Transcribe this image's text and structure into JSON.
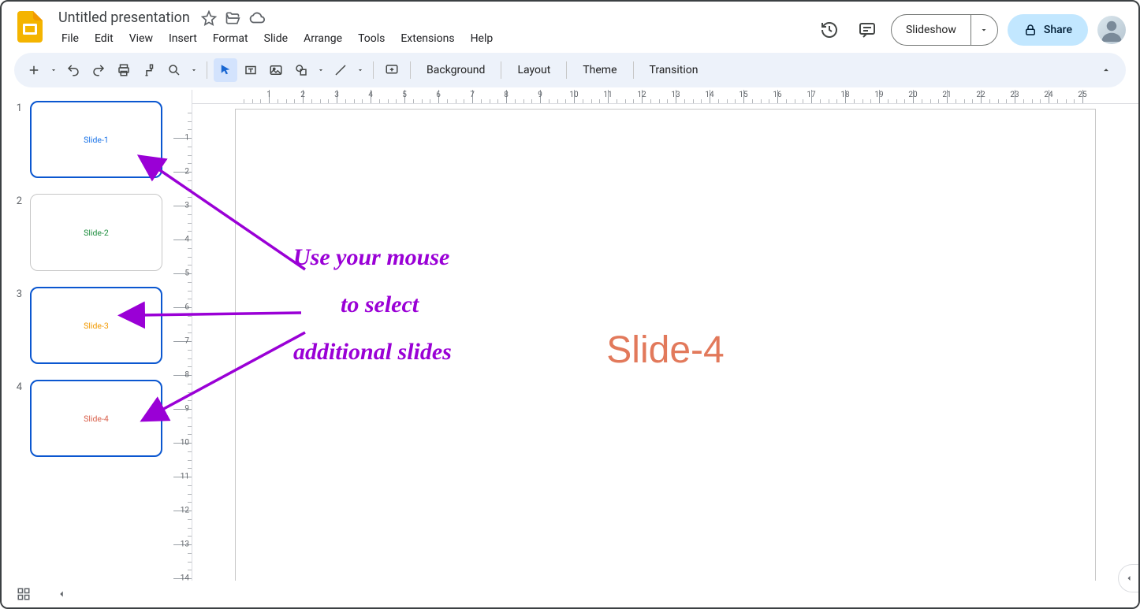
{
  "doc_title": "Untitled presentation",
  "menu": {
    "file": "File",
    "edit": "Edit",
    "view": "View",
    "insert": "Insert",
    "format": "Format",
    "slide": "Slide",
    "arrange": "Arrange",
    "tools": "Tools",
    "extensions": "Extensions",
    "help": "Help"
  },
  "header_buttons": {
    "slideshow": "Slideshow",
    "share": "Share"
  },
  "toolbar_text": {
    "background": "Background",
    "layout": "Layout",
    "theme": "Theme",
    "transition": "Transition"
  },
  "thumbnails": [
    {
      "num": "1",
      "label": "Slide-1",
      "color": "#1a73e8",
      "selected": true
    },
    {
      "num": "2",
      "label": "Slide-2",
      "color": "#1e8e3e",
      "selected": false
    },
    {
      "num": "3",
      "label": "Slide-3",
      "color": "#f29900",
      "selected": true
    },
    {
      "num": "4",
      "label": "Slide-4",
      "color": "#d9614c",
      "selected": true
    }
  ],
  "canvas": {
    "text": "Slide-4",
    "color": "#e2795b"
  },
  "annotation": {
    "line1": "Use your mouse",
    "line2": "to select",
    "line3": "additional slides"
  },
  "ruler": {
    "h_max": 25,
    "v_max": 14
  }
}
